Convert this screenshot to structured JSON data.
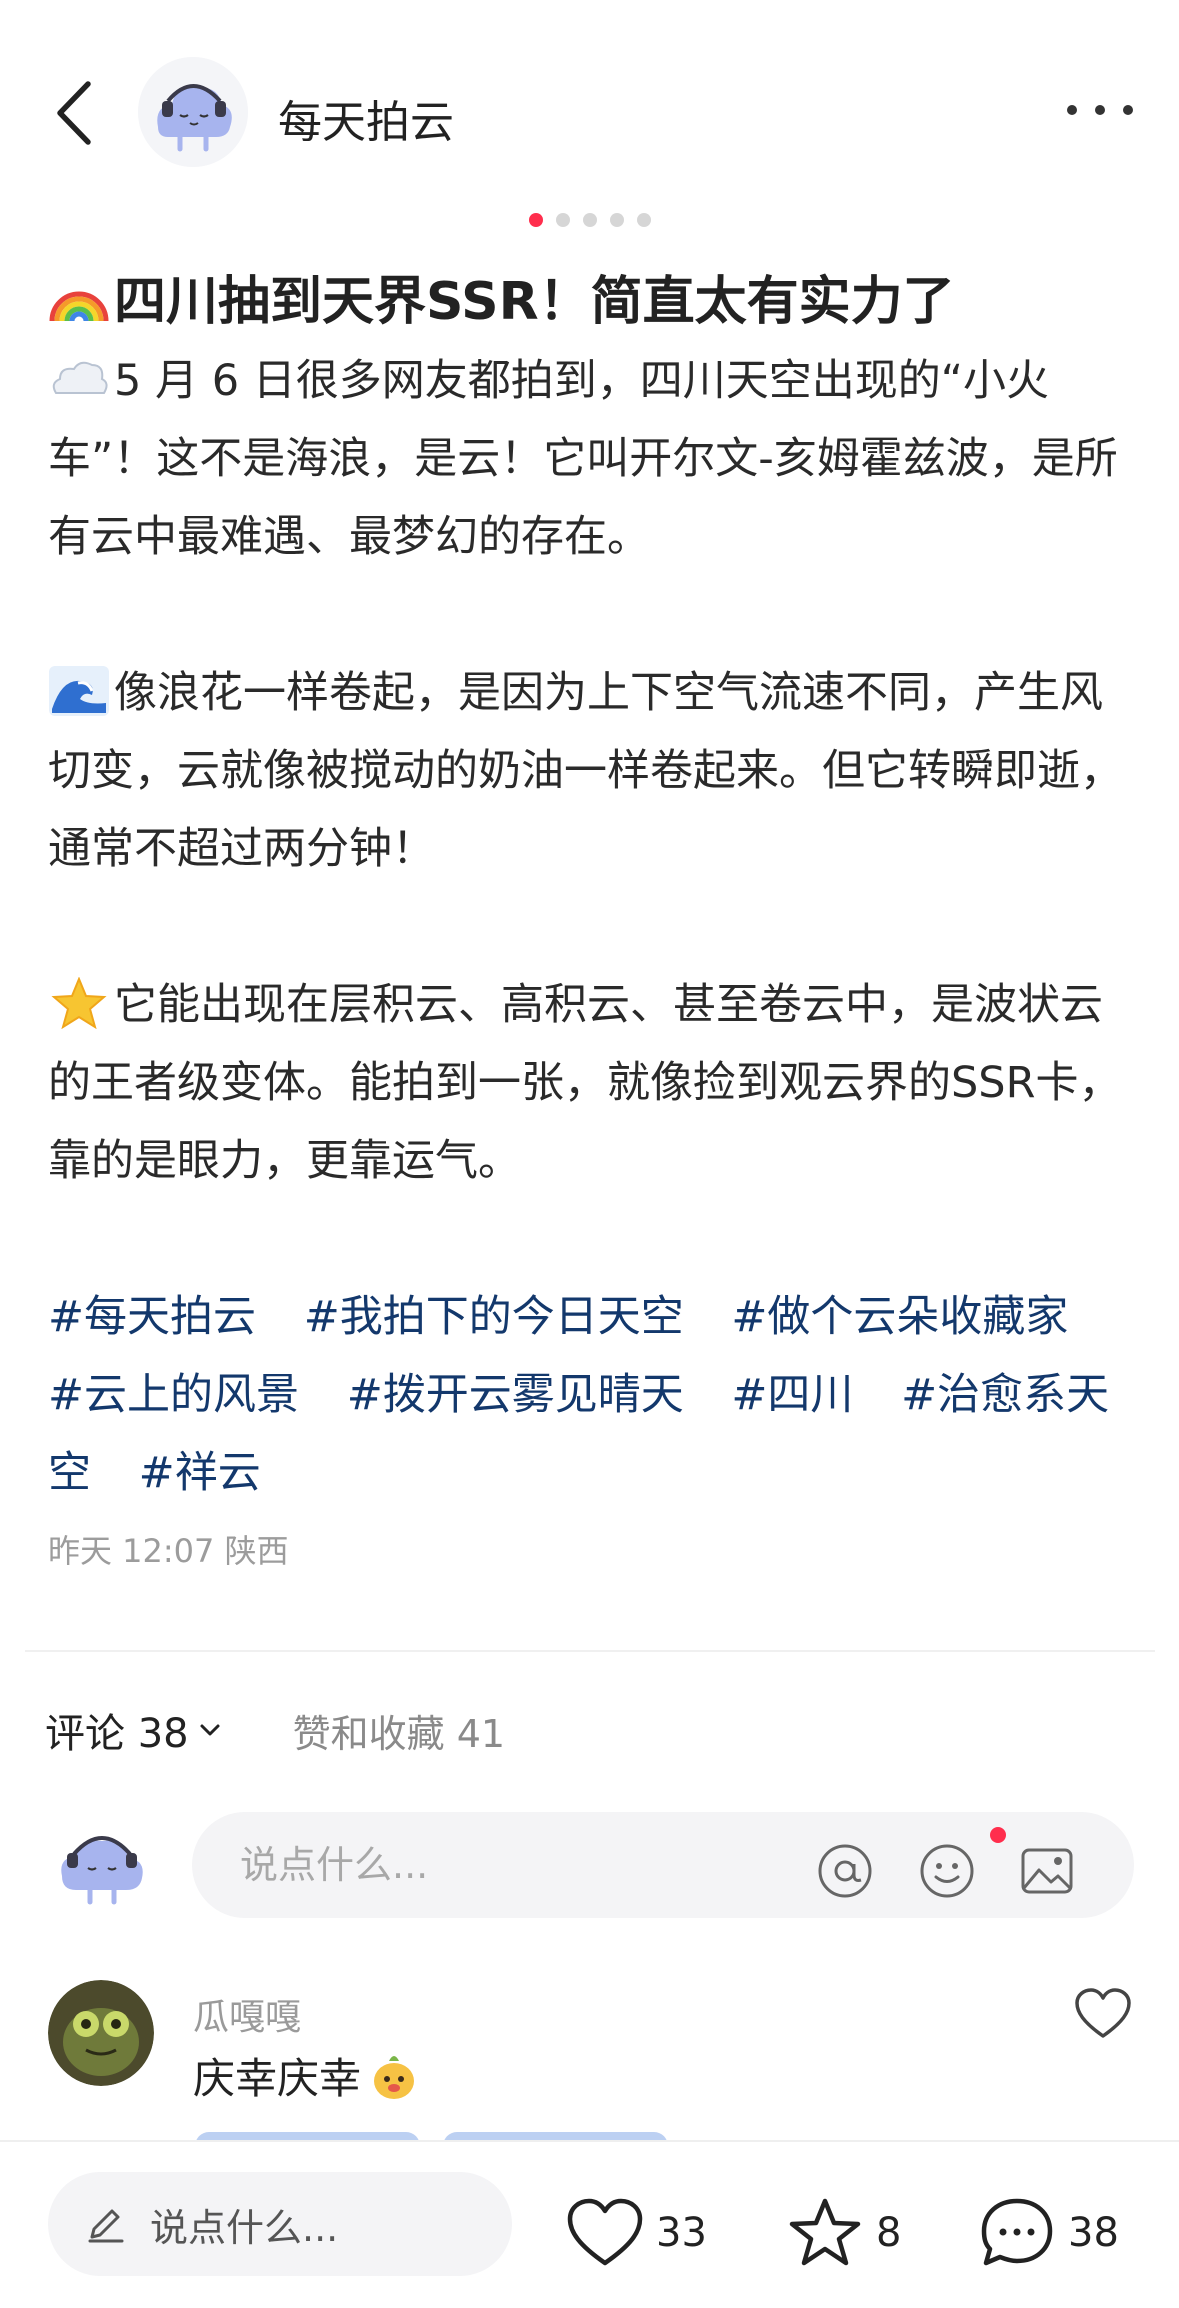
{
  "header": {
    "author_name": "每天拍云",
    "carousel_total": 5,
    "carousel_active_index": 0
  },
  "post": {
    "title": "四川抽到天界SSR！简直太有实力了",
    "paragraphs": [
      "5 月 6 日很多网友都拍到，四川天空出现的“小火车”！这不是海浪，是云！它叫开尔文-亥姆霍兹波，是所有云中最难遇、最梦幻的存在。",
      "像浪花一样卷起，是因为上下空气流速不同，产生风切变，云就像被搅动的奶油一样卷起来。但它转瞬即逝，通常不超过两分钟！",
      "它能出现在层积云、高积云、甚至卷云中，是波状云的王者级变体。能拍到一张，就像捡到观云界的SSR卡，靠的是眼力，更靠运气。"
    ],
    "tags": [
      "#每天拍云",
      "#我拍下的今日天空",
      "#做个云朵收藏家",
      "#云上的风景",
      "#拨开云雾见晴天",
      "#四川",
      "#治愈系天空",
      "#祥云"
    ],
    "meta": "昨天 12:07 陕西"
  },
  "comments_section": {
    "comments_label": "评论 38",
    "likes_label": "赞和收藏 41",
    "input_placeholder": "说点什么..."
  },
  "comments": [
    {
      "user": "瓜嘎嘎",
      "text": "庆幸庆幸"
    }
  ],
  "bottom_bar": {
    "input_label": "说点什么...",
    "like_count": "33",
    "star_count": "8",
    "comment_count": "38"
  },
  "colors": {
    "accent": "#ff2e4d",
    "tag_link": "#13386c",
    "muted_text": "#9c9c9c"
  },
  "icons": [
    "back-arrow-icon",
    "more-icon",
    "rainbow-emoji",
    "cloud-emoji",
    "wave-emoji",
    "star-emoji",
    "chevron-down-icon",
    "at-icon",
    "emoji-icon",
    "image-icon",
    "heart-icon",
    "pencil-icon",
    "star-icon",
    "chat-icon"
  ]
}
